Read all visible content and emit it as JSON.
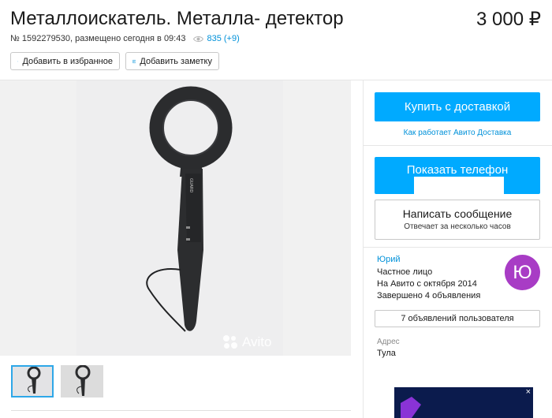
{
  "listing": {
    "title": "Металлоискатель. Металла- детектор",
    "price": "3 000 ₽",
    "meta": "№ 1592279530, размещено сегодня в 09:43",
    "views": "835 (+9)"
  },
  "actions": {
    "favorite_label": "Добавить в избранное",
    "note_label": "Добавить заметку"
  },
  "gallery": {
    "watermark": "Avito",
    "thumbnails": 2
  },
  "sidebar": {
    "buy_label": "Купить с доставкой",
    "delivery_link": "Как работает Авито Доставка",
    "phone_label": "Показать телефон",
    "message_label": "Написать сообщение",
    "message_sub": "Отвечает за несколько часов"
  },
  "seller": {
    "name": "Юрий",
    "type": "Частное лицо",
    "since": "На Авито с октября 2014",
    "completed": "Завершено 4 объявления",
    "avatar_letter": "Ю",
    "avatar_color": "#a83cc5",
    "ads_button": "7 объявлений пользователя"
  },
  "address": {
    "label": "Адрес",
    "value": "Тула"
  },
  "ad": {
    "close": "×"
  },
  "colors": {
    "accent": "#00aaff",
    "link": "#0091d9"
  }
}
